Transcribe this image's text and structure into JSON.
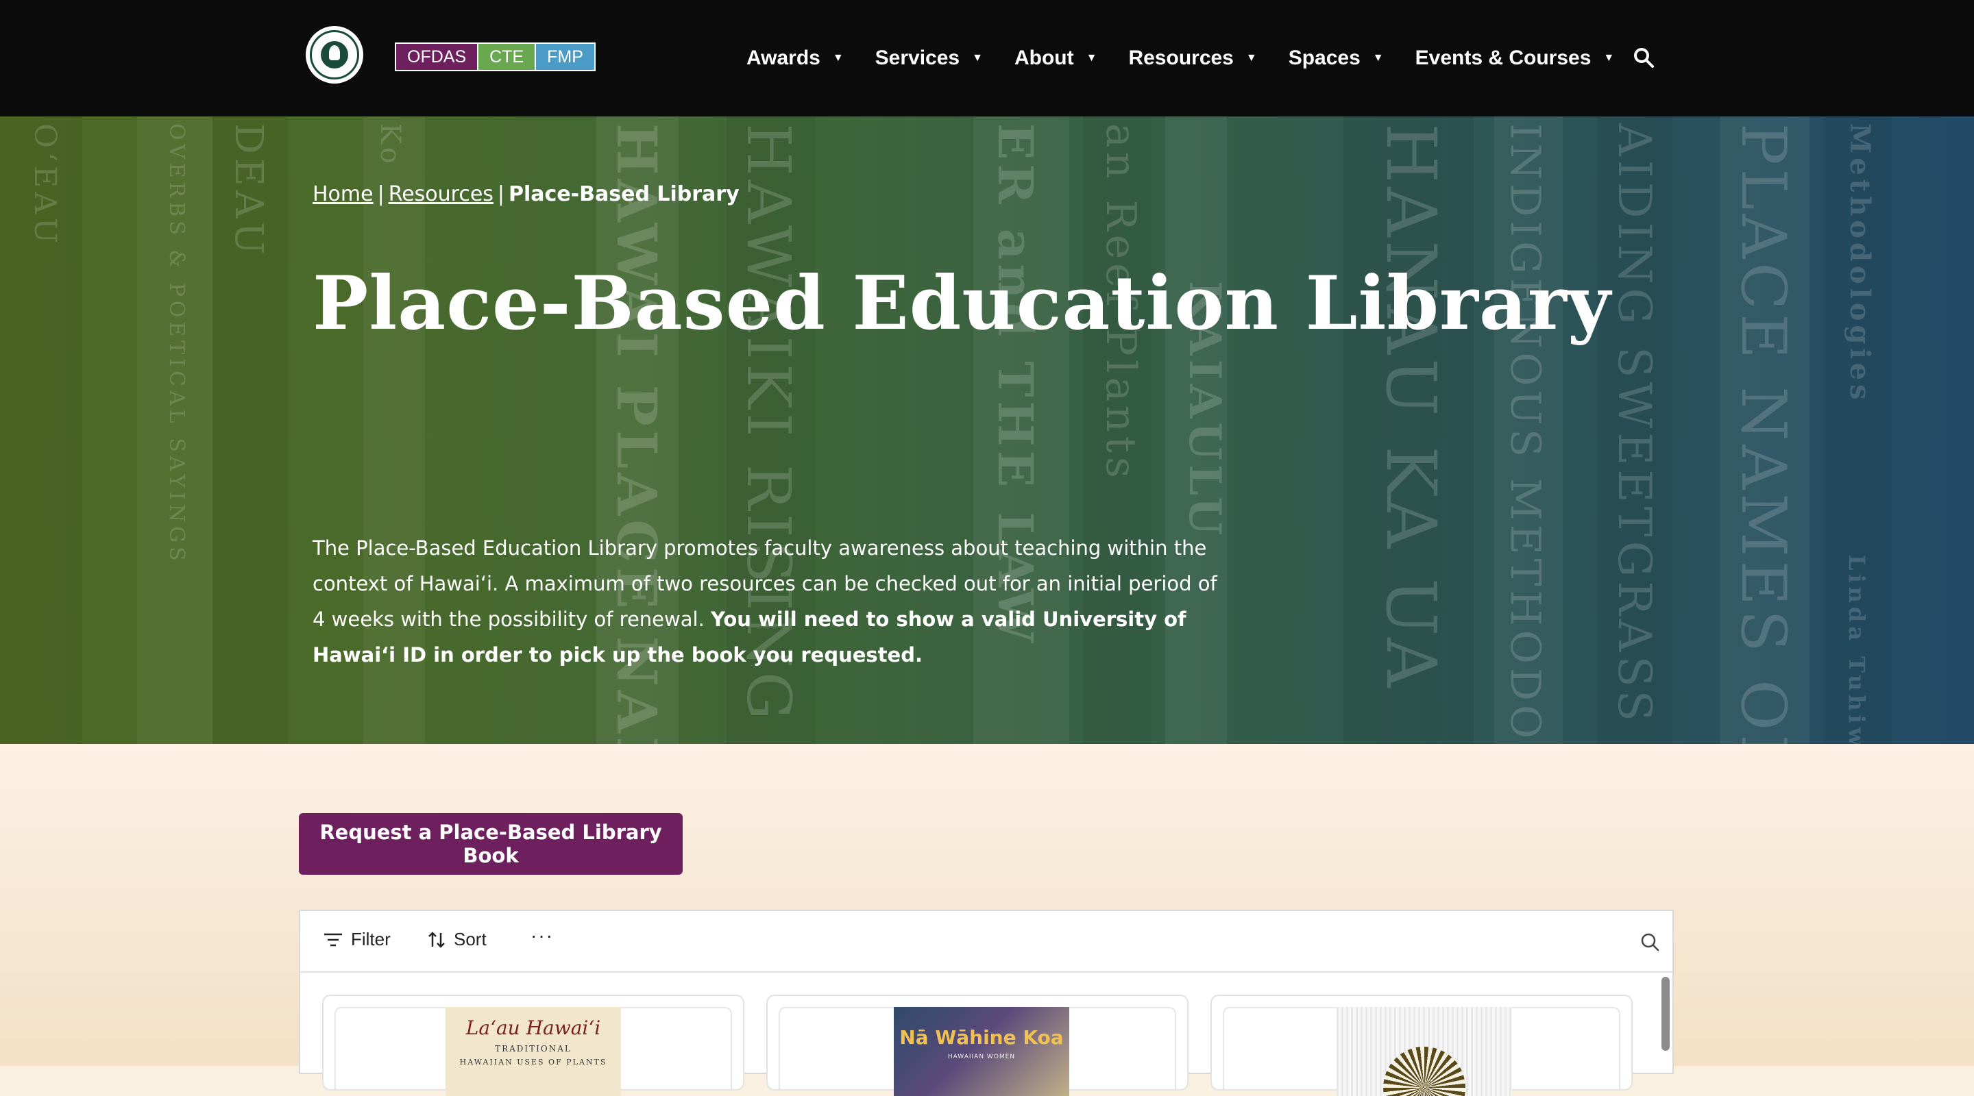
{
  "header": {
    "badges": [
      "OFDAS",
      "CTE",
      "FMP"
    ],
    "nav": [
      {
        "label": "Awards"
      },
      {
        "label": "Services"
      },
      {
        "label": "About"
      },
      {
        "label": "Resources"
      },
      {
        "label": "Spaces"
      },
      {
        "label": "Events & Courses"
      }
    ],
    "colors": {
      "ofdas": "#6d1f5e",
      "cte": "#6aa84f",
      "fmp": "#4a9bc6"
    }
  },
  "hero": {
    "breadcrumb": {
      "home": "Home",
      "resources": "Resources",
      "current": "Place-Based Library",
      "separator": "|"
    },
    "title": "Place-Based Education Library",
    "description_plain": "The Place-Based Education Library promotes faculty awareness about teaching within the context of Hawaiʻi. A maximum of two resources can be checked out for an initial period of 4 weeks with the possibility of renewal.",
    "description_bold": "You will need to show a valid University of Hawaiʻi ID in order to pick up the book you requested.",
    "spine_titles": [
      "OʻEAU",
      "OVERBS & POETICAL SAYINGS",
      "DEAU",
      "Ko",
      "HAWAI PLACE NAMES",
      "HAWAIKI RISING",
      "ER and THE LAW",
      "an Reef Plants",
      "KAIAULU",
      "HANAU KA UA",
      "INDIGENOUS METHODOLOGIES",
      "AIDING SWEETGRASS",
      "PLACE NAMES OF HAWAII",
      "Methodologies",
      "Linda Tuhiwai"
    ]
  },
  "content": {
    "request_button": "Request a Place-Based Library Book",
    "toolbar": {
      "filter": "Filter",
      "sort": "Sort",
      "more": "···"
    },
    "books": [
      {
        "title": "Laʻau Hawaiʻi",
        "subtitle": "TRADITIONAL",
        "subtitle2": "HAWAIIAN USES OF PLANTS"
      },
      {
        "title": "Nā Wāhine Koa",
        "subtitle": "HAWAIIAN WOMEN"
      },
      {
        "title": ""
      }
    ],
    "accent": "#6d1f5e"
  }
}
